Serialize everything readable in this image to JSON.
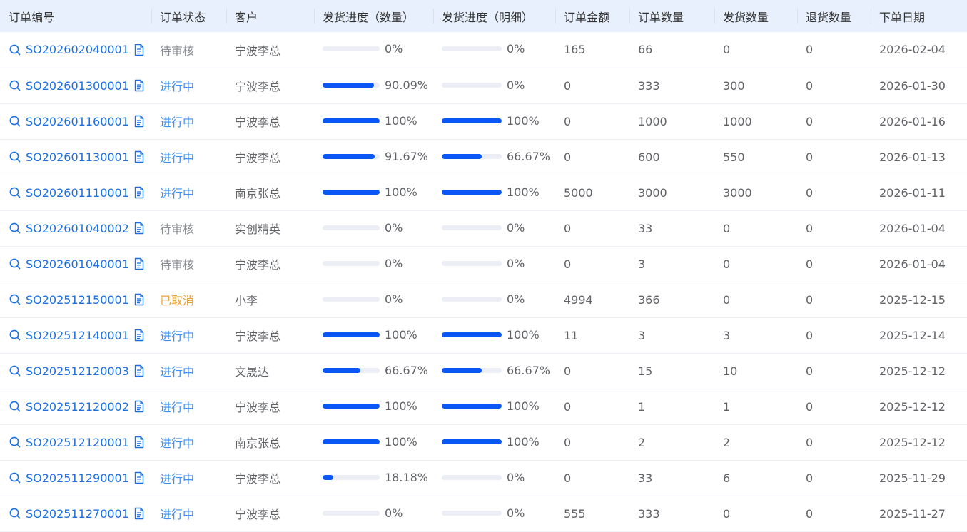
{
  "table": {
    "columns": [
      "订单编号",
      "订单状态",
      "客户",
      "发货进度（数量）",
      "发货进度（明细）",
      "订单金额",
      "订单数量",
      "发货数量",
      "退货数量",
      "下单日期"
    ],
    "rows": [
      {
        "order_no": "SO202602040001",
        "status": "待审核",
        "status_type": "pending",
        "customer": "宁波李总",
        "progress_qty": "0%",
        "progress_qty_value": 0,
        "progress_detail": "0%",
        "progress_detail_value": 0,
        "amount": "165",
        "order_qty": "66",
        "ship_qty": "0",
        "return_qty": "0",
        "order_date": "2026-02-04"
      },
      {
        "order_no": "SO202601300001",
        "status": "进行中",
        "status_type": "active",
        "customer": "宁波李总",
        "progress_qty": "90.09%",
        "progress_qty_value": 90.09,
        "progress_detail": "0%",
        "progress_detail_value": 0,
        "amount": "0",
        "order_qty": "333",
        "ship_qty": "300",
        "return_qty": "0",
        "order_date": "2026-01-30"
      },
      {
        "order_no": "SO202601160001",
        "status": "进行中",
        "status_type": "active",
        "customer": "宁波李总",
        "progress_qty": "100%",
        "progress_qty_value": 100,
        "progress_detail": "100%",
        "progress_detail_value": 100,
        "amount": "0",
        "order_qty": "1000",
        "ship_qty": "1000",
        "return_qty": "0",
        "order_date": "2026-01-16"
      },
      {
        "order_no": "SO202601130001",
        "status": "进行中",
        "status_type": "active",
        "customer": "宁波李总",
        "progress_qty": "91.67%",
        "progress_qty_value": 91.67,
        "progress_detail": "66.67%",
        "progress_detail_value": 66.67,
        "amount": "0",
        "order_qty": "600",
        "ship_qty": "550",
        "return_qty": "0",
        "order_date": "2026-01-13"
      },
      {
        "order_no": "SO202601110001",
        "status": "进行中",
        "status_type": "active",
        "customer": "南京张总",
        "progress_qty": "100%",
        "progress_qty_value": 100,
        "progress_detail": "100%",
        "progress_detail_value": 100,
        "amount": "5000",
        "order_qty": "3000",
        "ship_qty": "3000",
        "return_qty": "0",
        "order_date": "2026-01-11"
      },
      {
        "order_no": "SO202601040002",
        "status": "待审核",
        "status_type": "pending",
        "customer": "实创精英",
        "progress_qty": "0%",
        "progress_qty_value": 0,
        "progress_detail": "0%",
        "progress_detail_value": 0,
        "amount": "0",
        "order_qty": "33",
        "ship_qty": "0",
        "return_qty": "0",
        "order_date": "2026-01-04"
      },
      {
        "order_no": "SO202601040001",
        "status": "待审核",
        "status_type": "pending",
        "customer": "宁波李总",
        "progress_qty": "0%",
        "progress_qty_value": 0,
        "progress_detail": "0%",
        "progress_detail_value": 0,
        "amount": "0",
        "order_qty": "3",
        "ship_qty": "0",
        "return_qty": "0",
        "order_date": "2026-01-04"
      },
      {
        "order_no": "SO202512150001",
        "status": "已取消",
        "status_type": "cancel",
        "customer": "小李",
        "progress_qty": "0%",
        "progress_qty_value": 0,
        "progress_detail": "0%",
        "progress_detail_value": 0,
        "amount": "4994",
        "order_qty": "366",
        "ship_qty": "0",
        "return_qty": "0",
        "order_date": "2025-12-15"
      },
      {
        "order_no": "SO202512140001",
        "status": "进行中",
        "status_type": "active",
        "customer": "宁波李总",
        "progress_qty": "100%",
        "progress_qty_value": 100,
        "progress_detail": "100%",
        "progress_detail_value": 100,
        "amount": "11",
        "order_qty": "3",
        "ship_qty": "3",
        "return_qty": "0",
        "order_date": "2025-12-14"
      },
      {
        "order_no": "SO202512120003",
        "status": "进行中",
        "status_type": "active",
        "customer": "文晟达",
        "progress_qty": "66.67%",
        "progress_qty_value": 66.67,
        "progress_detail": "66.67%",
        "progress_detail_value": 66.67,
        "amount": "0",
        "order_qty": "15",
        "ship_qty": "10",
        "return_qty": "0",
        "order_date": "2025-12-12"
      },
      {
        "order_no": "SO202512120002",
        "status": "进行中",
        "status_type": "active",
        "customer": "宁波李总",
        "progress_qty": "100%",
        "progress_qty_value": 100,
        "progress_detail": "100%",
        "progress_detail_value": 100,
        "amount": "0",
        "order_qty": "1",
        "ship_qty": "1",
        "return_qty": "0",
        "order_date": "2025-12-12"
      },
      {
        "order_no": "SO202512120001",
        "status": "进行中",
        "status_type": "active",
        "customer": "南京张总",
        "progress_qty": "100%",
        "progress_qty_value": 100,
        "progress_detail": "100%",
        "progress_detail_value": 100,
        "amount": "0",
        "order_qty": "2",
        "ship_qty": "2",
        "return_qty": "0",
        "order_date": "2025-12-12"
      },
      {
        "order_no": "SO202511290001",
        "status": "进行中",
        "status_type": "active",
        "customer": "宁波李总",
        "progress_qty": "18.18%",
        "progress_qty_value": 18.18,
        "progress_detail": "0%",
        "progress_detail_value": 0,
        "amount": "0",
        "order_qty": "33",
        "ship_qty": "6",
        "return_qty": "0",
        "order_date": "2025-11-29"
      },
      {
        "order_no": "SO202511270001",
        "status": "进行中",
        "status_type": "active",
        "customer": "宁波李总",
        "progress_qty": "0%",
        "progress_qty_value": 0,
        "progress_detail": "0%",
        "progress_detail_value": 0,
        "amount": "555",
        "order_qty": "333",
        "ship_qty": "0",
        "return_qty": "0",
        "order_date": "2025-11-27"
      }
    ]
  },
  "icons": {
    "view": "search-icon",
    "detail": "document-icon"
  },
  "colors": {
    "link": "#1d6fe0",
    "status_active": "#3f8ef0",
    "status_pending": "#8a8d93",
    "status_cancel": "#e6a23c",
    "progress_fill": "#0a57f5",
    "progress_track": "#ebeef5",
    "header_bg": "#e8f0fd"
  }
}
